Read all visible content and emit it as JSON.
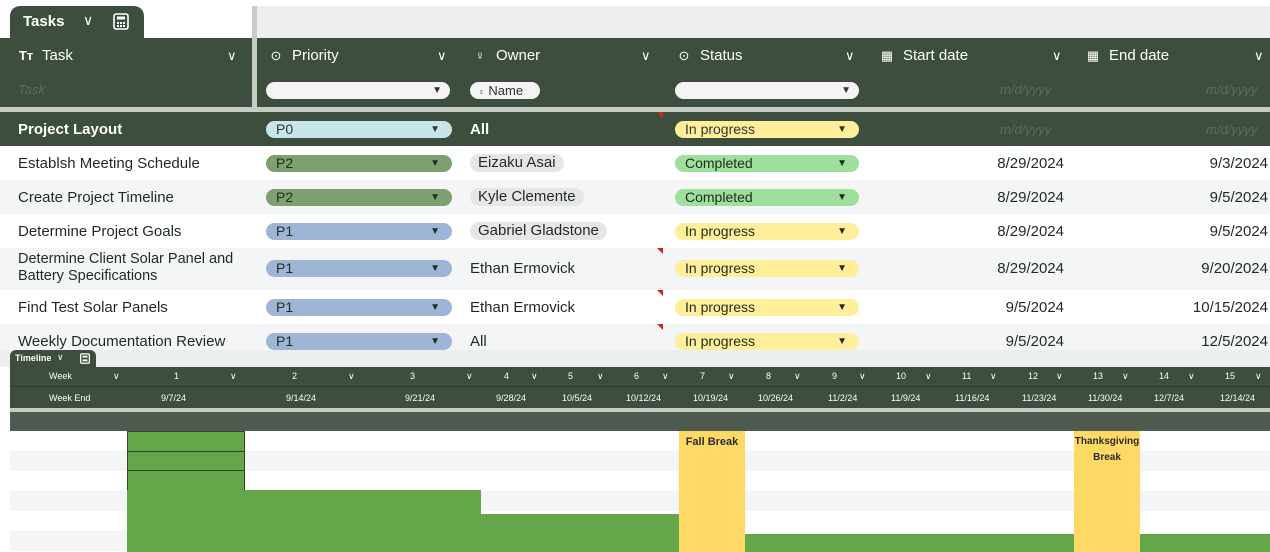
{
  "sheet_tab": {
    "label": "Tasks",
    "chevron": "⌄",
    "icon": "calculator-icon"
  },
  "columns": [
    {
      "key": "task",
      "label": "Task",
      "icon": "text-type-icon"
    },
    {
      "key": "priority",
      "label": "Priority",
      "icon": "select-icon"
    },
    {
      "key": "owner",
      "label": "Owner",
      "icon": "person-icon"
    },
    {
      "key": "status",
      "label": "Status",
      "icon": "select-icon"
    },
    {
      "key": "start",
      "label": "Start date",
      "icon": "calendar-icon"
    },
    {
      "key": "end",
      "label": "End date",
      "icon": "calendar-icon"
    }
  ],
  "filter": {
    "task_placeholder": "Task",
    "owner_placeholder": "Name",
    "date_placeholder": "m/d/yyyy"
  },
  "rows": [
    {
      "task": "Project Layout",
      "priority": "P0",
      "owner": "All",
      "status": "In progress",
      "start": "m/d/yyyy",
      "end": "m/d/yyyy"
    },
    {
      "task": "Establsh Meeting Schedule",
      "priority": "P2",
      "owner": "Eizaku Asai",
      "status": "Completed",
      "start": "8/29/2024",
      "end": "9/3/2024"
    },
    {
      "task": "Create Project Timeline",
      "priority": "P2",
      "owner": "Kyle Clemente",
      "status": "Completed",
      "start": "8/29/2024",
      "end": "9/5/2024"
    },
    {
      "task": "Determine Project Goals",
      "priority": "P1",
      "owner": "Gabriel Gladstone",
      "status": "In progress",
      "start": "8/29/2024",
      "end": "9/5/2024"
    },
    {
      "task_line1": "Determine Client Solar Panel and",
      "task_line2": "Battery Specifications",
      "priority": "P1",
      "owner": "Ethan Ermovick",
      "status": "In progress",
      "start": "8/29/2024",
      "end": "9/20/2024"
    },
    {
      "task": "Find Test Solar Panels",
      "priority": "P1",
      "owner": "Ethan Ermovick",
      "status": "In progress",
      "start": "9/5/2024",
      "end": "10/15/2024"
    },
    {
      "task": "Weekly Documentation Review",
      "priority": "P1",
      "owner": "All",
      "status": "In progress",
      "start": "9/5/2024",
      "end": "12/5/2024"
    }
  ],
  "colors": {
    "header_bg": "#3d4e3e",
    "p0": "#c6e6e8",
    "p1": "#9fb5d6",
    "p2": "#7ea06f",
    "in_progress": "#ffef9a",
    "completed": "#9ddf9b",
    "timeline_bar": "#65a64a",
    "break": "#ffd966"
  },
  "timeline": {
    "tab_label": "Timeline",
    "week_label": "Week",
    "weekend_label": "Week End",
    "weeks": [
      "1",
      "2",
      "3",
      "4",
      "5",
      "6",
      "7",
      "8",
      "9",
      "10",
      "11",
      "12",
      "13",
      "14",
      "15"
    ],
    "week_ends": [
      "9/7/24",
      "9/14/24",
      "9/21/24",
      "9/28/24",
      "10/5/24",
      "10/12/24",
      "10/19/24",
      "10/26/24",
      "11/2/24",
      "11/9/24",
      "11/16/24",
      "11/23/24",
      "11/30/24",
      "12/7/24",
      "12/14/24"
    ],
    "breaks": [
      "Fall Break",
      "Thanksgiving",
      "Break"
    ]
  }
}
